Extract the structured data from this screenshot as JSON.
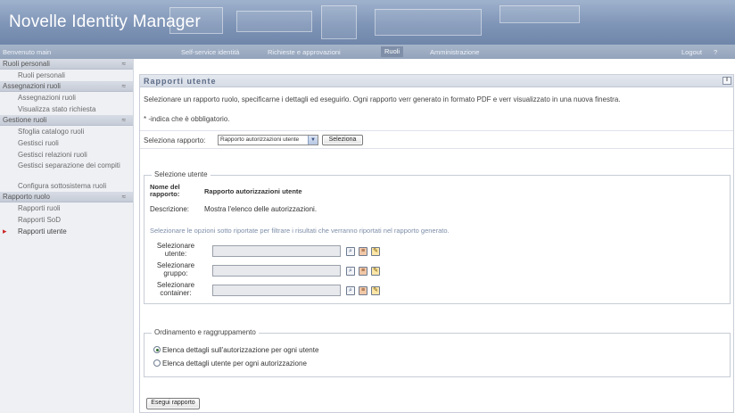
{
  "app": {
    "title": "Novelle Identity Manager"
  },
  "nav": {
    "welcome": "Benvenuto main",
    "tabs": [
      {
        "label": "Self-service identità"
      },
      {
        "label": "Richieste e approvazioni"
      },
      {
        "label": "Ruoli"
      },
      {
        "label": "Amministrazione"
      }
    ],
    "logout": "Logout",
    "help": "?"
  },
  "sidebar": {
    "sections": [
      {
        "header": "Ruoli personali",
        "items": [
          {
            "label": "Ruoli personali"
          }
        ]
      },
      {
        "header": "Assegnazioni ruoli",
        "items": [
          {
            "label": "Assegnazioni ruoli"
          },
          {
            "label": "Visualizza stato richiesta"
          }
        ]
      },
      {
        "header": "Gestione ruoli",
        "items": [
          {
            "label": "Sfoglia catalogo ruoli"
          },
          {
            "label": "Gestisci ruoli"
          },
          {
            "label": "Gestisci relazioni ruoli"
          },
          {
            "label": "Gestisci separazione dei compiti"
          },
          {
            "label": "Configura sottosistema ruoli"
          }
        ]
      },
      {
        "header": "Rapporto ruolo",
        "items": [
          {
            "label": "Rapporti ruoli"
          },
          {
            "label": "Rapporti SoD"
          },
          {
            "label": "Rapporti utente"
          }
        ]
      }
    ],
    "collapse_glyph": "≈"
  },
  "panel": {
    "title": "Rapporti utente",
    "help_glyph": "‖",
    "intro": "Selezionare un rapporto ruolo, specificarne i dettagli ed eseguirlo. Ogni rapporto verr generato in formato PDF e verr visualizzato in una nuova finestra.",
    "required_note": "* -indica che è obbligatorio.",
    "select_report": {
      "label": "Seleziona rapporto:",
      "value": "Rapporto autorizzazioni utente",
      "button": "Seleziona"
    },
    "user_selection": {
      "legend": "Selezione utente",
      "report_name_label": "Nome del rapporto:",
      "report_name_value": "Rapporto autorizzazioni utente",
      "description_label": "Descrizione:",
      "description_value": "Mostra l'elenco delle autorizzazioni.",
      "hint": "Selezionare le opzioni sotto riportate per filtrare i risultati che verranno riportati nel rapporto generato.",
      "fields": [
        {
          "label": "Selezionare utente:",
          "value": ""
        },
        {
          "label": "Selezionare gruppo:",
          "value": ""
        },
        {
          "label": "Selezionare container:",
          "value": ""
        }
      ]
    },
    "sorting": {
      "legend": "Ordinamento e raggruppamento",
      "options": [
        {
          "label": "Elenca dettagli sull'autorizzazione per ogni utente",
          "checked": true
        },
        {
          "label": "Elenca dettagli utente per ogni autorizzazione",
          "checked": false
        }
      ]
    },
    "run_button": "Esegui rapporto"
  },
  "icons": {
    "lookup": "magnifier-icon",
    "history": "history-book-icon",
    "edit": "edit-pencil-icon"
  }
}
